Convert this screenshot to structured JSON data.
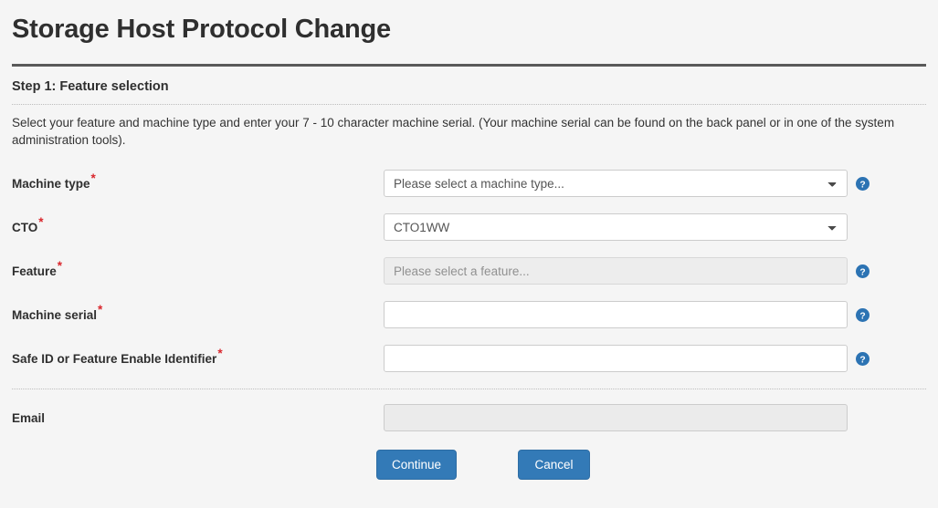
{
  "page": {
    "title": "Storage Host Protocol Change",
    "step_heading": "Step 1: Feature selection",
    "intro": "Select your feature and machine type and enter your 7 - 10 character machine serial. (Your machine serial can be found on the back panel or in one of the system administration tools)."
  },
  "colors": {
    "accent": "#337ab7",
    "required_asterisk": "#d9262c",
    "background": "#f5f5f5",
    "rule": "#595959",
    "help_icon": "#2c73b3"
  },
  "form": {
    "rows": [
      {
        "label": "Machine type",
        "required": true,
        "required_mark": "*",
        "control": "select",
        "value": "Please select a machine type...",
        "options": [
          "Please select a machine type..."
        ],
        "disabled": false,
        "help_icon": "help-circle-icon",
        "has_help": true
      },
      {
        "label": "CTO",
        "required": true,
        "required_mark": "*",
        "control": "select",
        "value": "CTO1WW",
        "options": [
          "CTO1WW"
        ],
        "disabled": false,
        "help_icon": null,
        "has_help": false
      },
      {
        "label": "Feature",
        "required": true,
        "required_mark": "*",
        "control": "select",
        "value": "Please select a feature...",
        "options": [
          "Please select a feature..."
        ],
        "disabled": true,
        "help_icon": "help-circle-icon",
        "has_help": true
      },
      {
        "label": "Machine serial",
        "required": true,
        "required_mark": "*",
        "control": "text",
        "value": "",
        "placeholder": "",
        "disabled": false,
        "help_icon": "help-circle-icon",
        "has_help": true
      },
      {
        "label": "Safe ID or Feature Enable Identifier",
        "required": true,
        "required_mark": "*",
        "control": "text",
        "value": "",
        "placeholder": "",
        "disabled": false,
        "help_icon": "help-circle-icon",
        "has_help": true
      }
    ],
    "email_row": {
      "label": "Email",
      "required": false,
      "control": "text",
      "value": "",
      "placeholder": "",
      "disabled": true,
      "has_help": false
    }
  },
  "buttons": {
    "continue_label": "Continue",
    "cancel_label": "Cancel"
  }
}
